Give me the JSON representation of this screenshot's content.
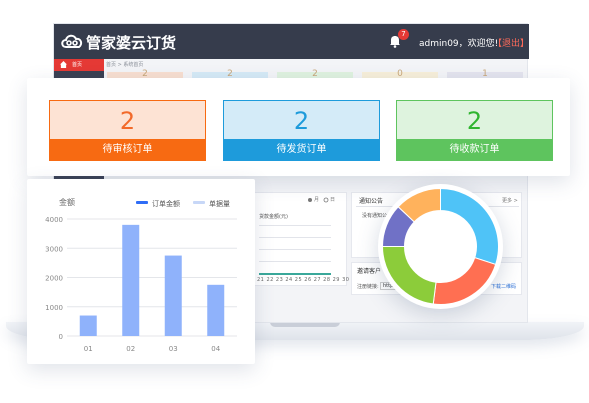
{
  "app": {
    "brand": "管家婆云订货",
    "username": "admin09，欢迎您!",
    "logout": "【退出】",
    "notification_count": "7"
  },
  "sidebar": {
    "home": "首页"
  },
  "breadcrumb": "首页 > 系统首页",
  "back_cards": [
    {
      "value": "2",
      "color": "#f8dfd0"
    },
    {
      "value": "2",
      "color": "#d5eaf6"
    },
    {
      "value": "2",
      "color": "#dff2df"
    },
    {
      "value": "0",
      "color": "#f7efd9"
    },
    {
      "value": "1",
      "color": "#e4e4ee"
    }
  ],
  "status_cards": [
    {
      "value": "2",
      "label": "待审核订单",
      "bg": "#fde3d4",
      "accent": "#f76a12",
      "num_color": "#f26a2a"
    },
    {
      "value": "2",
      "label": "待发货订单",
      "bg": "#d4ebf8",
      "accent": "#1e9bdb",
      "num_color": "#1e9bdb"
    },
    {
      "value": "2",
      "label": "待收款订单",
      "bg": "#def3de",
      "accent": "#5ec45e",
      "num_color": "#2fb52f"
    }
  ],
  "sales_panel": {
    "legend_month": "月",
    "legend_day": "日",
    "subtitle": "货款金额(元)",
    "x_ticks": "21 22 23 24 25 26 27 28 29 30 31"
  },
  "notice_panel": {
    "title": "通知公告",
    "more": "更多 >",
    "item": "没有通知公告"
  },
  "invite_panel": {
    "title": "邀请客户",
    "link_label": "注册链接:",
    "link_value": "http",
    "qr_label": "下载二维码"
  },
  "chart_data": {
    "type": "bar",
    "categories": [
      "01",
      "02",
      "03",
      "04"
    ],
    "series": [
      {
        "name": "订单金额",
        "values": [
          700,
          3800,
          2750,
          1750
        ],
        "color": "#8fb2fb"
      }
    ],
    "legend": [
      {
        "name": "订单金额",
        "color": "#2f6df6"
      },
      {
        "name": "单据量",
        "color": "#c7d7f7"
      }
    ],
    "ylabel": "金额",
    "ylim": [
      0,
      4000
    ],
    "yticks": [
      "0",
      "1000",
      "2000",
      "3000",
      "4000"
    ],
    "grid": true,
    "legend_position": "top-right"
  },
  "donut_data": {
    "type": "pie",
    "values": [
      30,
      22,
      23,
      12,
      13
    ],
    "colors": [
      "#4fc3f7",
      "#ff6f52",
      "#8ccc3a",
      "#7071c6",
      "#ffb25c"
    ]
  }
}
